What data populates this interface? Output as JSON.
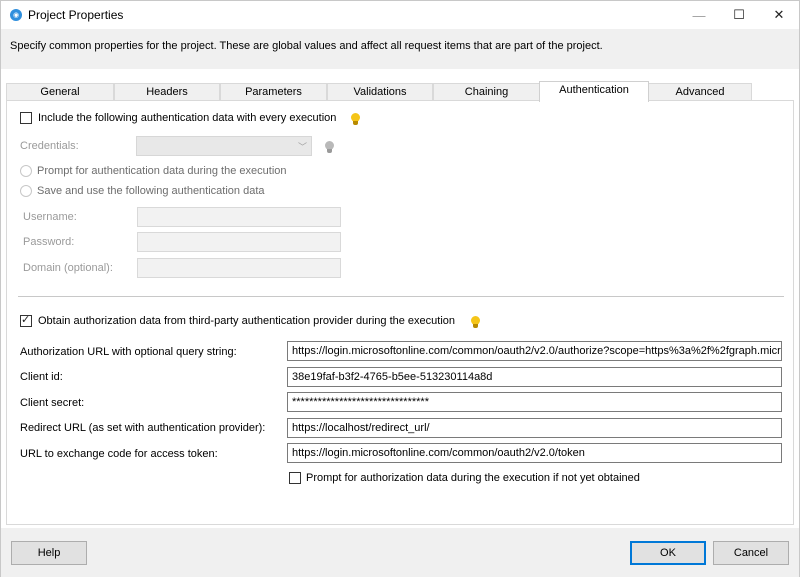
{
  "window": {
    "title": "Project Properties",
    "minimize": "—",
    "maximize": "☐",
    "close": "✕"
  },
  "description": "Specify common properties for the project. These are global values and affect all request items that are part of the project.",
  "tabs": [
    "General",
    "Headers",
    "Parameters",
    "Validations",
    "Chaining",
    "Authentication",
    "Advanced"
  ],
  "active_tab": "Authentication",
  "auth": {
    "include_label": "Include the following authentication data with every execution",
    "include_checked": false,
    "credentials_label": "Credentials:",
    "credentials_value": "",
    "prompt_label": "Prompt for authentication data during the execution",
    "save_label": "Save and use the following authentication data",
    "username_label": "Username:",
    "password_label": "Password:",
    "domain_label": "Domain (optional):"
  },
  "oauth": {
    "obtain_label": "Obtain authorization data from third-party authentication provider during the execution",
    "obtain_checked": true,
    "auth_url_label": "Authorization URL with optional query string:",
    "auth_url_value": "https://login.microsoftonline.com/common/oauth2/v2.0/authorize?scope=https%3a%2f%2fgraph.micr",
    "client_id_label": "Client id:",
    "client_id_value": "38e19faf-b3f2-4765-b5ee-513230114a8d",
    "client_secret_label": "Client secret:",
    "client_secret_value": "********************************",
    "redirect_label": "Redirect URL (as set with authentication provider):",
    "redirect_value": "https://localhost/redirect_url/",
    "token_url_label": "URL to exchange code for access token:",
    "token_url_value": "https://login.microsoftonline.com/common/oauth2/v2.0/token",
    "prompt_if_missing_label": "Prompt for authorization data during the execution if not yet obtained",
    "prompt_if_missing_checked": false
  },
  "buttons": {
    "help": "Help",
    "ok": "OK",
    "cancel": "Cancel"
  },
  "colors": {
    "accent": "#0078d7",
    "bulb": "#f5c518"
  }
}
